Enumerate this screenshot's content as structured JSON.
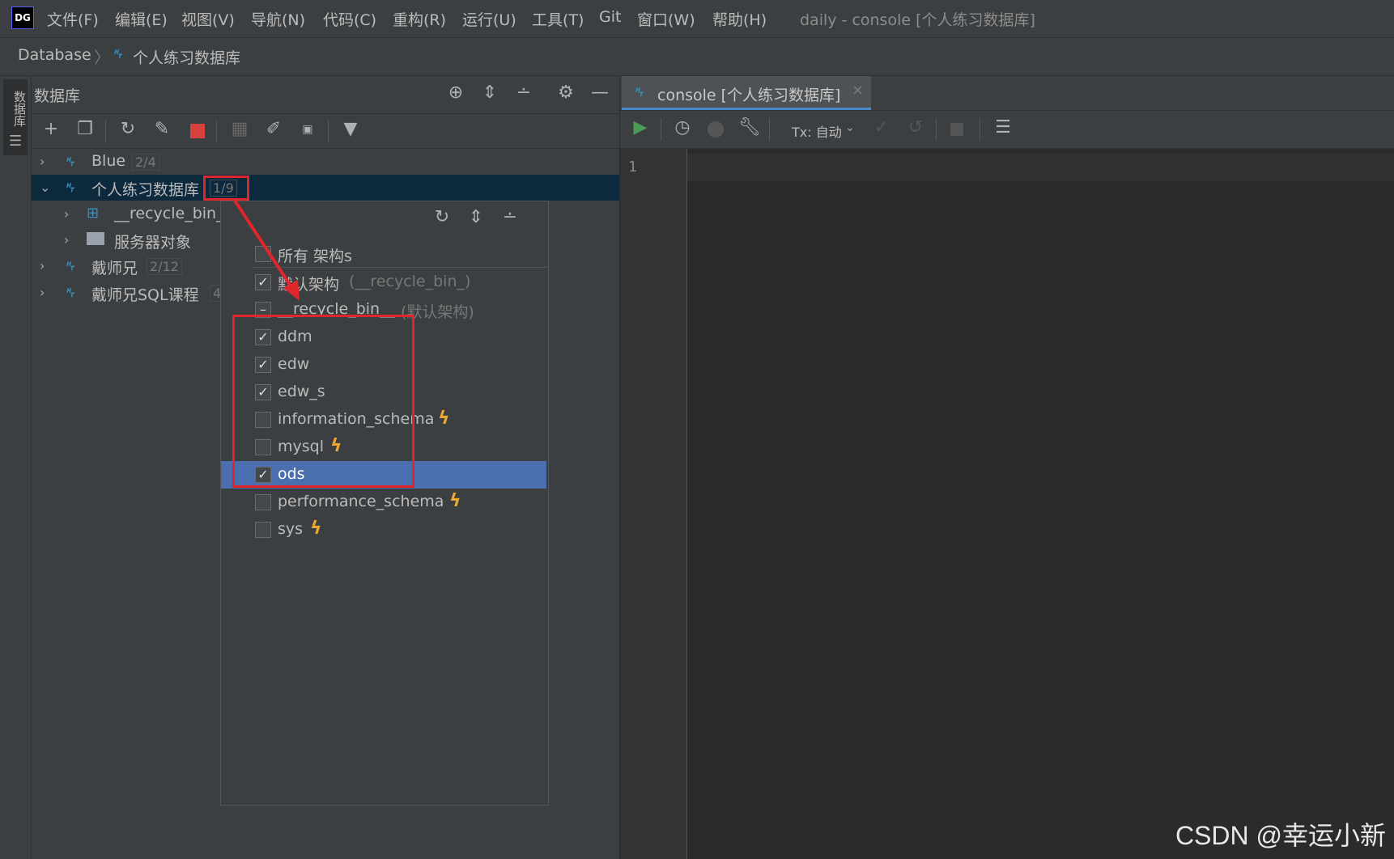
{
  "app": {
    "logo": "DG",
    "window_title": "daily - console [个人练习数据库]"
  },
  "menu": [
    "文件(F)",
    "编辑(E)",
    "视图(V)",
    "导航(N)",
    "代码(C)",
    "重构(R)",
    "运行(U)",
    "工具(T)",
    "Git",
    "窗口(W)",
    "帮助(H)"
  ],
  "breadcrumb": {
    "root": "Database",
    "current": "个人练习数据库"
  },
  "left_strip": {
    "label": "数据库"
  },
  "db_panel": {
    "title": "数据库",
    "tree": [
      {
        "label": "Blue",
        "count": "2/4",
        "expanded": false
      },
      {
        "label": "个人练习数据库",
        "count": "1/9",
        "expanded": true,
        "selected": true
      },
      {
        "label": "__recycle_bin_",
        "child": true
      },
      {
        "label": "服务器对象",
        "child": true
      },
      {
        "label": "戴师兄",
        "count": "2/12"
      },
      {
        "label": "戴师兄SQL课程",
        "count": "4"
      }
    ]
  },
  "schema_popup": {
    "all_label": "所有 架构s",
    "default_label": "默认架构",
    "default_hint": "(__recycle_bin_)",
    "recycle_label": "__recycle_bin__",
    "recycle_hint": "(默认架构)",
    "schemas": [
      {
        "name": "ddm",
        "checked": true,
        "bolt": false
      },
      {
        "name": "edw",
        "checked": true,
        "bolt": false
      },
      {
        "name": "edw_s",
        "checked": true,
        "bolt": false
      },
      {
        "name": "information_schema",
        "checked": false,
        "bolt": true
      },
      {
        "name": "mysql",
        "checked": false,
        "bolt": true
      },
      {
        "name": "ods",
        "checked": true,
        "bolt": false,
        "highlighted": true
      },
      {
        "name": "performance_schema",
        "checked": false,
        "bolt": true
      },
      {
        "name": "sys",
        "checked": false,
        "bolt": true
      }
    ]
  },
  "console": {
    "tab_label": "console [个人练习数据库]",
    "tx_label": "Tx: 自动",
    "line_number": "1"
  },
  "watermark": "CSDN @幸运小新",
  "colors": {
    "accent_blue": "#4b6eaf",
    "annotation_red": "#e0262c",
    "run_green": "#499c54",
    "bolt_orange": "#f0a732"
  }
}
